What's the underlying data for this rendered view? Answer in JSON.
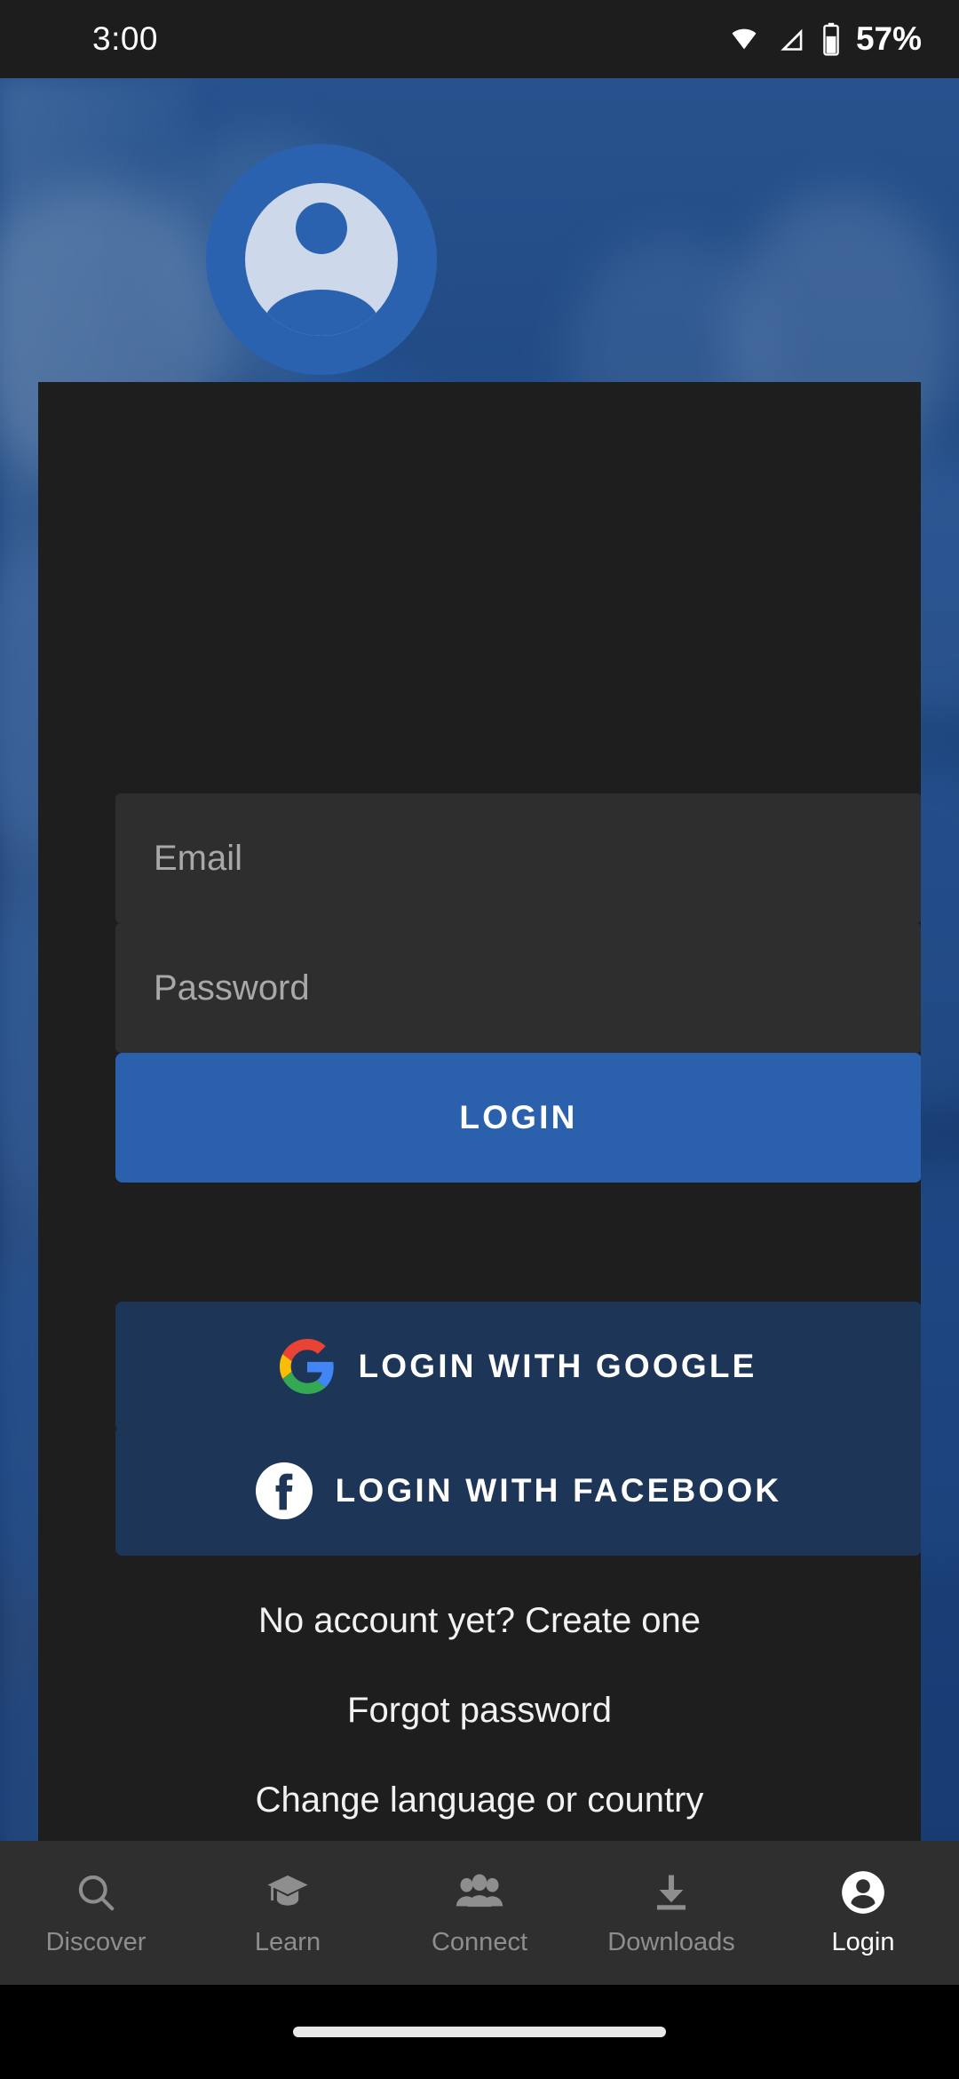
{
  "status_bar": {
    "time": "3:00",
    "battery_percent": "57%",
    "icons": [
      "wifi-icon",
      "cellular-signal-icon",
      "battery-icon"
    ]
  },
  "colors": {
    "accent_blue": "#2a60ac",
    "avatar_blue": "#2a62b0",
    "social_button_bg": "#1d3557",
    "card_bg": "#1e1e1e",
    "field_bg": "#2e2e2e",
    "nav_bg": "#2f2f2f",
    "placeholder_text": "#a8a8a8",
    "active_nav_text": "#ffffff",
    "inactive_nav_text": "#8e8e8e"
  },
  "login_card": {
    "avatar_icon": "user-avatar-icon",
    "email": {
      "value": "",
      "placeholder": "Email"
    },
    "password": {
      "value": "",
      "placeholder": "Password"
    },
    "login_button": "LOGIN",
    "google_button": "LOGIN WITH GOOGLE",
    "facebook_button": "LOGIN WITH FACEBOOK",
    "links": [
      "No account yet? Create one",
      "Forgot password",
      "Change language or country"
    ]
  },
  "bottom_nav": {
    "items": [
      {
        "label": "Discover",
        "icon": "search-icon",
        "active": false
      },
      {
        "label": "Learn",
        "icon": "graduation-cap-icon",
        "active": false
      },
      {
        "label": "Connect",
        "icon": "people-group-icon",
        "active": false
      },
      {
        "label": "Downloads",
        "icon": "download-icon",
        "active": false
      },
      {
        "label": "Login",
        "icon": "person-icon",
        "active": true
      }
    ]
  }
}
